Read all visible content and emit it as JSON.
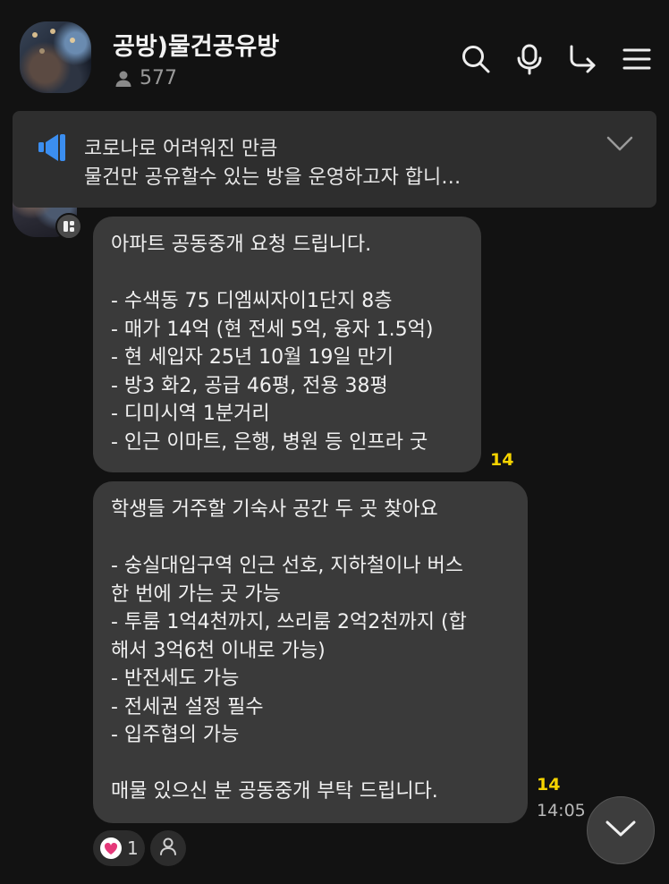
{
  "header": {
    "title": "공방)물건공유방",
    "member_count": "577",
    "icons": [
      "search-icon",
      "mic-icon",
      "share-icon",
      "menu-icon"
    ]
  },
  "notice": {
    "line1": "코로나로 어려워진 만큼",
    "line2": "물건만 공유할수 있는 방을 운영하고자 합니…"
  },
  "messages": [
    {
      "text": "아파트 공동중개 요청 드립니다.\n\n- 수색동 75 디엠씨자이1단지 8층\n- 매가 14억 (현 전세 5억, 융자 1.5억)\n- 현 세입자 25년 10월 19일 만기\n- 방3 화2, 공급 46평, 전용 38평\n- 디미시역 1분거리\n- 인근 이마트, 은행, 병원 등 인프라 굿",
      "unread": "14"
    },
    {
      "text": "학생들 거주할 기숙사 공간 두 곳 찾아요\n\n- 숭실대입구역 인근 선호, 지하철이나 버스\n한 번에 가는 곳 가능\n- 투룸 1억4천까지, 쓰리룸 2억2천까지 (합\n해서 3억6천 이내로 가능)\n- 반전세도 가능\n- 전세권 설정 필수\n- 입주협의 가능\n\n매물 있으신 분 공동중개 부탁 드립니다.",
      "unread": "14",
      "time": "14:05"
    }
  ],
  "reaction": {
    "count": "1"
  },
  "colors": {
    "background": "#121212",
    "bubble": "#3a3a3a",
    "unread": "#f5d300",
    "notice_icon": "#3b8ef0",
    "heart": "#e5397a"
  }
}
